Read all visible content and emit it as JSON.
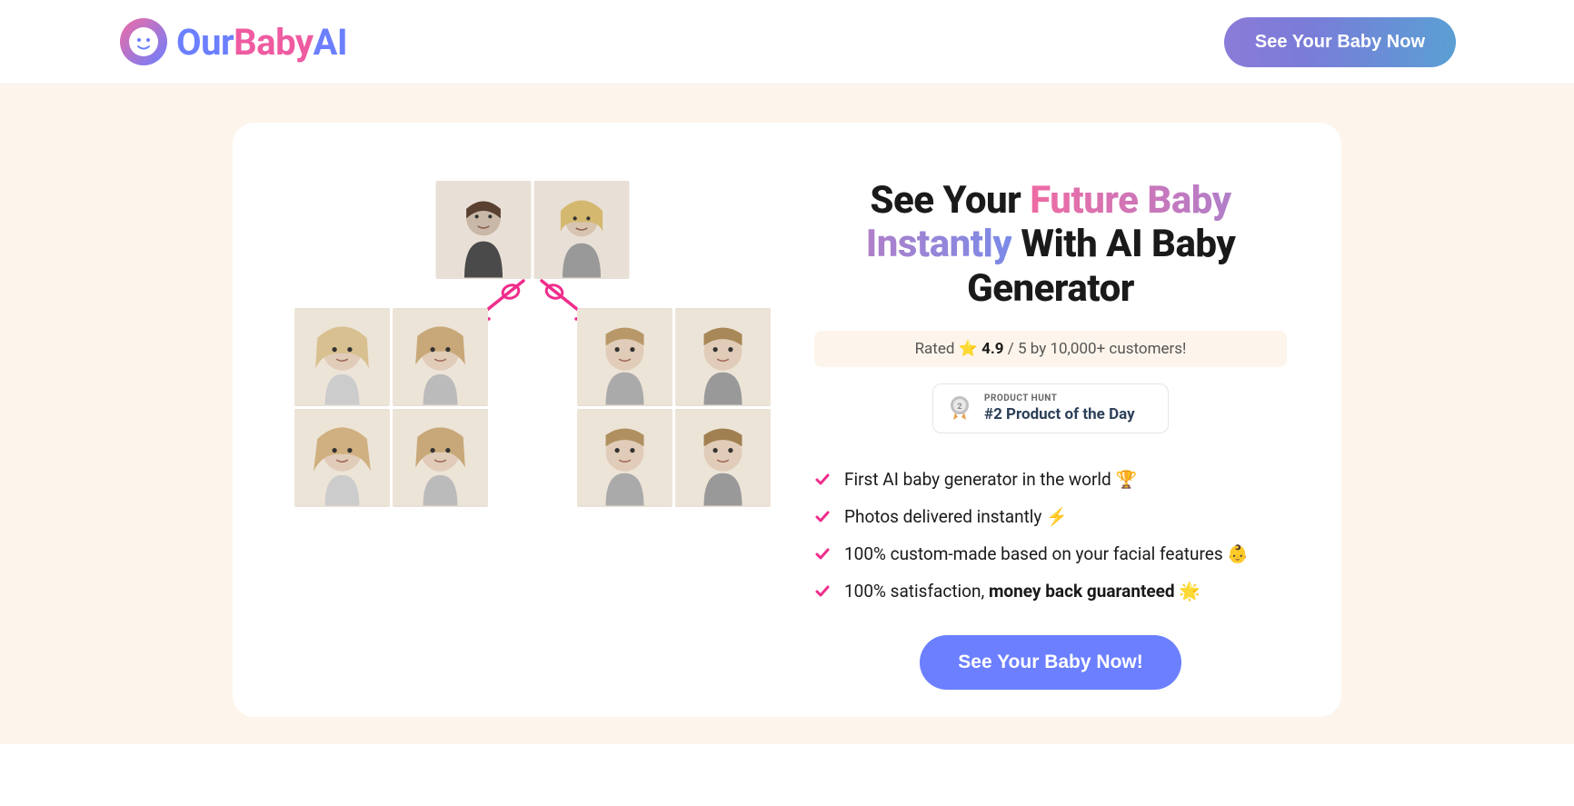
{
  "header": {
    "logo": {
      "our": "Our",
      "baby": "Baby",
      "ai": "AI"
    },
    "cta": "See Your Baby Now"
  },
  "hero": {
    "headline": {
      "p1": "See Your ",
      "grad1": "Future Baby",
      "grad2": "Instantly",
      "p2": " With AI Baby Generator"
    },
    "rating": {
      "prefix": "Rated ",
      "score": "4.9",
      "mid": " / 5 by 10,000+ customers!"
    },
    "ph": {
      "top": "PRODUCT HUNT",
      "bot": "#2 Product of the Day"
    },
    "features": [
      {
        "text": "First AI baby generator in the world ",
        "emoji": "🏆"
      },
      {
        "text": "Photos delivered instantly ",
        "emoji": "⚡"
      },
      {
        "text": "100% custom-made based on your facial features ",
        "emoji": "👶"
      },
      {
        "pre": "100% satisfaction, ",
        "bold": "money back guaranteed",
        "emoji": " 🌟"
      }
    ],
    "cta": "See Your Baby Now!"
  }
}
